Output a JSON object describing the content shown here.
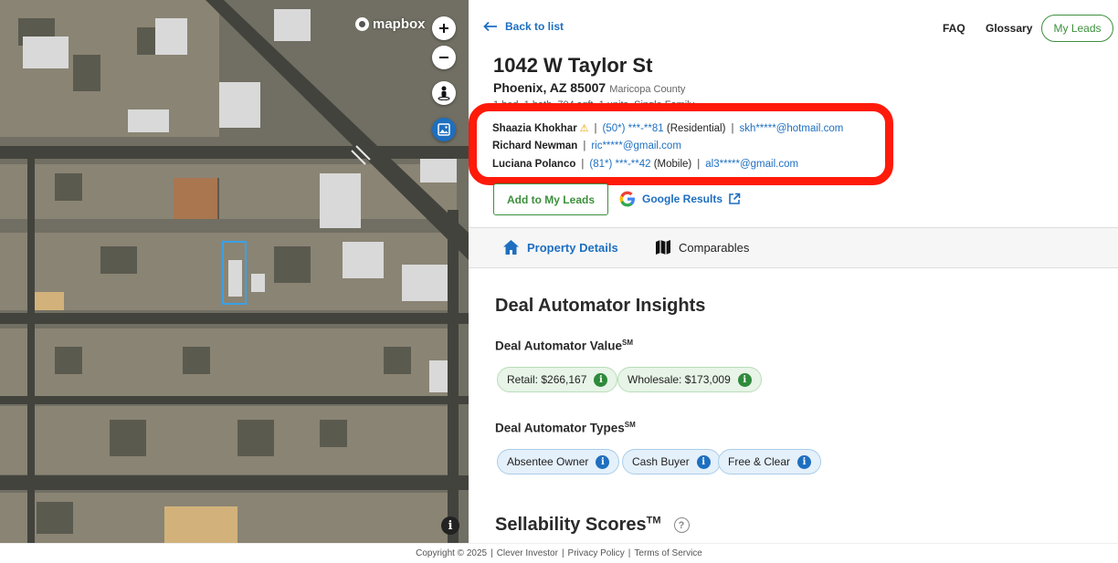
{
  "map": {
    "provider": "mapbox",
    "controls": [
      "zoom-in",
      "zoom-out",
      "street-view",
      "satellite-layer"
    ]
  },
  "nav": {
    "back_label": "Back to list",
    "faq": "FAQ",
    "glossary": "Glossary",
    "my_leads": "My Leads"
  },
  "property": {
    "address": "1042 W Taylor St",
    "city_state_zip": "Phoenix, AZ 85007",
    "county": "Maricopa County",
    "specs": "1 bed, 1 bath, 704 sqft, 1 units, Single Family"
  },
  "contacts": [
    {
      "name": "Shaazia Khokhar",
      "warning": "⚠",
      "phone": "(50*) ***-**81",
      "phone_type": "(Residential)",
      "email": "skh*****@hotmail.com"
    },
    {
      "name": "Richard Newman",
      "email": "ric*****@gmail.com"
    },
    {
      "name": "Luciana Polanco",
      "phone": "(81*) ***-**42",
      "phone_type": "(Mobile)",
      "email": "al3*****@gmail.com"
    }
  ],
  "actions": {
    "add_to_leads": "Add to My Leads",
    "google_results": "Google Results"
  },
  "tabs": {
    "property_details": "Property Details",
    "comparables": "Comparables"
  },
  "insights": {
    "title": "Deal Automator Insights",
    "value_heading": "Deal Automator Value",
    "value_mark": "SM",
    "retail": "Retail: $266,167",
    "wholesale": "Wholesale: $173,009",
    "types_heading": "Deal Automator Types",
    "types_mark": "SM",
    "types": [
      "Absentee Owner",
      "Cash Buyer",
      "Free & Clear"
    ],
    "sellability": "Sellability Scores",
    "sellability_mark": "TM"
  },
  "footer": {
    "copyright": "Copyright © 2025",
    "brand": "Clever Investor",
    "privacy": "Privacy Policy",
    "terms": "Terms of Service"
  },
  "colors": {
    "accent_blue": "#1e6fc0",
    "accent_green": "#3c8f3c",
    "highlight_red": "#ff1a0a"
  }
}
